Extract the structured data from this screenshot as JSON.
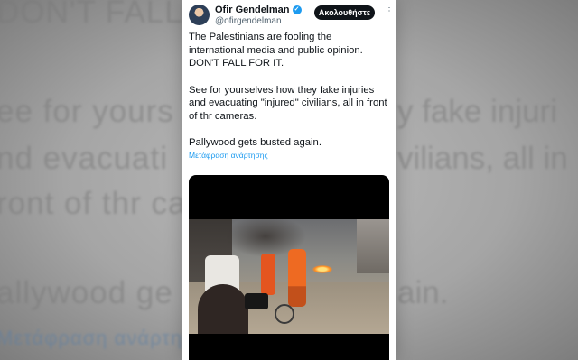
{
  "background": {
    "lines": [
      "DON'T FALL FOR IT.",
      "ee for yours",
      "nd evacuati",
      "ront of thr ca",
      "allywood ge",
      "Μετάφραση ανάρτησης"
    ],
    "right_lines": [
      "y fake injuri",
      "vilians, all in",
      "ain."
    ]
  },
  "tweet": {
    "author_name": "Ofir Gendelman",
    "handle": "@ofirgendelman",
    "follow_label": "Ακολουθήστε",
    "more_icon": "⋮",
    "verified_icon": "verified-badge-icon",
    "paragraphs": [
      "The Palestinians are fooling the international media and public opinion. DON'T FALL FOR IT.",
      "See for yourselves how they fake injuries and evacuating \"injured\" civilians, all in front of thr cameras.",
      "Pallywood gets busted again."
    ],
    "translate_link": "Μετάφραση ανάρτησης"
  },
  "colors": {
    "accent": "#1d9bf0",
    "text": "#0f1419",
    "secondary": "#536471",
    "follow_bg": "#0f1419"
  }
}
